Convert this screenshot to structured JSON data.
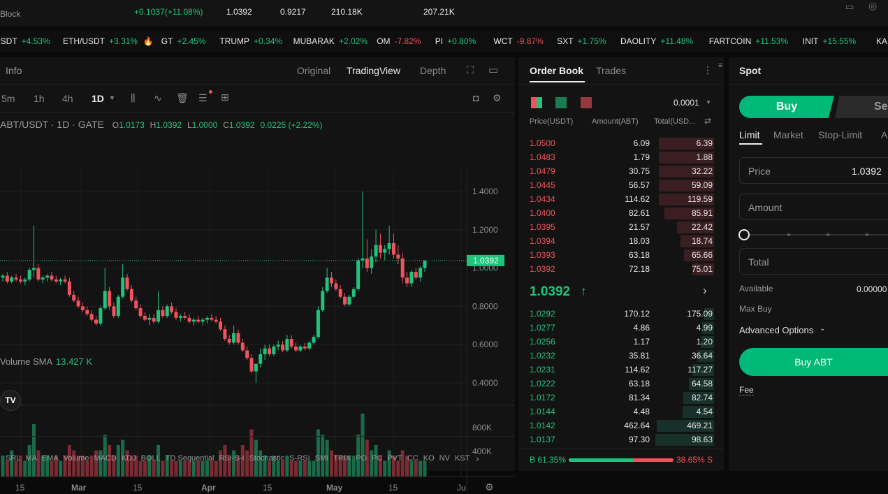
{
  "stats": {
    "left_label": "Block",
    "change": "+0.1037(+11.08%)",
    "high": "1.0392",
    "low": "0.9217",
    "vol1": "210.18K",
    "vol2": "207.21K"
  },
  "ticker": [
    {
      "sym": "USDT",
      "chg": "+4.53%",
      "up": true
    },
    {
      "sym": "ETH/USDT",
      "chg": "+3.31%",
      "up": true
    },
    {
      "sym": "GT",
      "chg": "+2.45%",
      "up": true
    },
    {
      "sym": "TRUMP",
      "chg": "+0.34%",
      "up": true
    },
    {
      "sym": "MUBARAK",
      "chg": "+2.02%",
      "up": true
    },
    {
      "sym": "OM",
      "chg": "-7.82%",
      "up": false
    },
    {
      "sym": "PI",
      "chg": "+0.80%",
      "up": true
    },
    {
      "sym": "WCT",
      "chg": "-9.87%",
      "up": false
    },
    {
      "sym": "SXT",
      "chg": "+1.75%",
      "up": true
    },
    {
      "sym": "DAOLITY",
      "chg": "+11.48%",
      "up": true
    },
    {
      "sym": "FARTCOIN",
      "chg": "+11.53%",
      "up": true
    },
    {
      "sym": "INIT",
      "chg": "+15.55%",
      "up": true
    },
    {
      "sym": "KAIT",
      "chg": "",
      "up": true
    }
  ],
  "chart_panel": {
    "info_tab": "Info",
    "view_tabs": [
      "Original",
      "TradingView",
      "Depth"
    ],
    "active_view": "TradingView",
    "intervals": [
      "5m",
      "1h",
      "4h",
      "1D"
    ],
    "active_interval": "1D",
    "symbol_line": "ABT/USDT · 1D · GATE",
    "o_label": "O",
    "o_val": "1.0173",
    "h_label": "H",
    "h_val": "1.0392",
    "l_label": "L",
    "l_val": "1.0000",
    "c_label": "C",
    "c_val": "1.0392",
    "chg_val": "0.0225 (+2.22%)",
    "volume_label": "Volume SMA",
    "volume_val": "13.427 K",
    "indicators": [
      "SRL",
      "MA",
      "EMA",
      "Volume",
      "MACD",
      "KDJ",
      "BOLL",
      "TD Sequential",
      "RSI-S-I",
      "Stochastic",
      "S-RSI",
      "SMI",
      "TRIX",
      "PO",
      "PC",
      "PVT",
      "CC",
      "KO",
      "NV",
      "KST"
    ]
  },
  "chart_data": {
    "type": "candlestick",
    "price_ticks": [
      "1.4000",
      "1.2000",
      "1.0000",
      "0.8000",
      "0.6000",
      "0.4000"
    ],
    "volume_ticks": [
      "800K",
      "400K"
    ],
    "x_ticks": [
      "15",
      "Mar",
      "15",
      "Apr",
      "15",
      "May",
      "15",
      "Ju"
    ],
    "last_price": "1.0392",
    "ylim": [
      0.3,
      1.5
    ],
    "candles": [
      [
        0.95,
        0.97,
        0.93,
        0.96
      ],
      [
        0.96,
        0.98,
        0.92,
        0.93
      ],
      [
        0.93,
        0.96,
        0.92,
        0.95
      ],
      [
        0.95,
        0.97,
        0.93,
        0.94
      ],
      [
        0.94,
        0.96,
        0.92,
        0.93
      ],
      [
        0.93,
        0.95,
        0.91,
        0.94
      ],
      [
        0.94,
        1.0,
        0.93,
        0.99
      ],
      [
        0.99,
        1.22,
        0.95,
        1.0
      ],
      [
        1.0,
        1.02,
        0.93,
        0.94
      ],
      [
        0.94,
        0.96,
        0.92,
        0.95
      ],
      [
        0.95,
        0.97,
        0.93,
        0.96
      ],
      [
        0.96,
        0.98,
        0.93,
        0.94
      ],
      [
        0.94,
        0.96,
        0.92,
        0.93
      ],
      [
        0.93,
        0.95,
        0.91,
        0.94
      ],
      [
        0.94,
        0.96,
        0.92,
        0.93
      ],
      [
        0.93,
        0.95,
        0.85,
        0.86
      ],
      [
        0.86,
        0.88,
        0.82,
        0.83
      ],
      [
        0.83,
        0.85,
        0.79,
        0.8
      ],
      [
        0.8,
        0.82,
        0.77,
        0.78
      ],
      [
        0.78,
        0.8,
        0.75,
        0.76
      ],
      [
        0.76,
        0.78,
        0.72,
        0.73
      ],
      [
        0.73,
        0.75,
        0.7,
        0.71
      ],
      [
        0.71,
        0.8,
        0.7,
        0.79
      ],
      [
        0.79,
        1.0,
        0.78,
        0.88
      ],
      [
        0.88,
        0.9,
        0.78,
        0.8
      ],
      [
        0.8,
        0.82,
        0.74,
        0.75
      ],
      [
        0.75,
        0.86,
        0.74,
        0.85
      ],
      [
        0.85,
        1.02,
        0.84,
        0.95
      ],
      [
        0.95,
        0.97,
        0.88,
        0.89
      ],
      [
        0.89,
        0.91,
        0.82,
        0.83
      ],
      [
        0.83,
        0.85,
        0.78,
        0.79
      ],
      [
        0.79,
        0.81,
        0.74,
        0.75
      ],
      [
        0.75,
        0.77,
        0.72,
        0.73
      ],
      [
        0.73,
        0.76,
        0.7,
        0.74
      ],
      [
        0.74,
        0.76,
        0.71,
        0.72
      ],
      [
        0.72,
        0.88,
        0.71,
        0.78
      ],
      [
        0.78,
        0.8,
        0.74,
        0.75
      ],
      [
        0.75,
        0.81,
        0.74,
        0.8
      ],
      [
        0.8,
        0.82,
        0.76,
        0.77
      ],
      [
        0.77,
        0.79,
        0.73,
        0.74
      ],
      [
        0.74,
        0.76,
        0.72,
        0.75
      ],
      [
        0.75,
        0.77,
        0.73,
        0.74
      ],
      [
        0.74,
        0.76,
        0.71,
        0.72
      ],
      [
        0.72,
        0.74,
        0.7,
        0.73
      ],
      [
        0.73,
        0.75,
        0.71,
        0.72
      ],
      [
        0.72,
        0.74,
        0.7,
        0.73
      ],
      [
        0.73,
        0.75,
        0.71,
        0.74
      ],
      [
        0.74,
        0.76,
        0.72,
        0.73
      ],
      [
        0.73,
        0.75,
        0.71,
        0.72
      ],
      [
        0.72,
        0.74,
        0.67,
        0.68
      ],
      [
        0.68,
        0.7,
        0.62,
        0.63
      ],
      [
        0.63,
        0.65,
        0.6,
        0.61
      ],
      [
        0.61,
        0.7,
        0.6,
        0.66
      ],
      [
        0.66,
        0.68,
        0.6,
        0.61
      ],
      [
        0.61,
        0.63,
        0.56,
        0.57
      ],
      [
        0.57,
        0.59,
        0.52,
        0.53
      ],
      [
        0.53,
        0.55,
        0.45,
        0.46
      ],
      [
        0.46,
        0.48,
        0.4,
        0.5
      ],
      [
        0.5,
        0.58,
        0.48,
        0.55
      ],
      [
        0.55,
        0.6,
        0.52,
        0.58
      ],
      [
        0.58,
        0.6,
        0.54,
        0.55
      ],
      [
        0.55,
        0.6,
        0.54,
        0.59
      ],
      [
        0.59,
        0.62,
        0.57,
        0.6
      ],
      [
        0.6,
        0.62,
        0.56,
        0.57
      ],
      [
        0.57,
        0.65,
        0.56,
        0.63
      ],
      [
        0.63,
        0.65,
        0.58,
        0.59
      ],
      [
        0.59,
        0.61,
        0.56,
        0.57
      ],
      [
        0.57,
        0.6,
        0.56,
        0.59
      ],
      [
        0.59,
        0.61,
        0.57,
        0.58
      ],
      [
        0.58,
        0.62,
        0.57,
        0.61
      ],
      [
        0.61,
        0.65,
        0.6,
        0.64
      ],
      [
        0.64,
        0.8,
        0.63,
        0.78
      ],
      [
        0.78,
        0.9,
        0.77,
        0.88
      ],
      [
        0.88,
        1.0,
        0.87,
        0.95
      ],
      [
        0.95,
        0.98,
        0.9,
        0.92
      ],
      [
        0.92,
        0.94,
        0.88,
        0.89
      ],
      [
        0.89,
        0.91,
        0.84,
        0.85
      ],
      [
        0.85,
        0.87,
        0.8,
        0.81
      ],
      [
        0.81,
        0.86,
        0.8,
        0.85
      ],
      [
        0.85,
        0.9,
        0.84,
        0.89
      ],
      [
        0.89,
        1.05,
        0.88,
        1.04
      ],
      [
        1.04,
        1.4,
        1.0,
        1.05
      ],
      [
        1.05,
        1.15,
        0.98,
        1.0
      ],
      [
        1.0,
        1.1,
        0.97,
        1.06
      ],
      [
        1.06,
        1.2,
        1.03,
        1.12
      ],
      [
        1.12,
        1.18,
        1.05,
        1.08
      ],
      [
        1.08,
        1.12,
        1.04,
        1.1
      ],
      [
        1.1,
        1.22,
        1.07,
        1.13
      ],
      [
        1.13,
        1.18,
        1.05,
        1.07
      ],
      [
        1.07,
        1.12,
        1.02,
        1.05
      ],
      [
        1.05,
        1.08,
        0.92,
        0.95
      ],
      [
        0.95,
        0.98,
        0.9,
        0.92
      ],
      [
        0.92,
        0.99,
        0.9,
        0.98
      ],
      [
        0.98,
        1.0,
        0.94,
        0.95
      ],
      [
        0.95,
        1.01,
        0.93,
        1.0
      ],
      [
        1.0,
        1.04,
        0.98,
        1.0392
      ]
    ],
    "volumes": [
      4,
      3,
      5,
      3,
      4,
      3,
      6,
      10,
      5,
      4,
      4,
      3,
      4,
      3,
      4,
      6,
      5,
      4,
      4,
      3,
      4,
      5,
      5,
      8,
      6,
      4,
      6,
      7,
      5,
      4,
      4,
      3,
      3,
      4,
      3,
      6,
      3,
      4,
      3,
      3,
      3,
      3,
      3,
      3,
      3,
      3,
      3,
      3,
      3,
      5,
      6,
      4,
      5,
      4,
      6,
      5,
      9,
      7,
      5,
      4,
      3,
      4,
      3,
      3,
      4,
      3,
      3,
      3,
      3,
      3,
      3,
      9,
      8,
      7,
      5,
      4,
      4,
      4,
      4,
      4,
      8,
      12,
      7,
      5,
      6,
      4,
      3,
      5,
      4,
      3,
      5,
      4,
      3,
      3,
      3,
      3
    ]
  },
  "orderbook": {
    "tabs": [
      "Order Book",
      "Trades"
    ],
    "active_tab": "Order Book",
    "precision": "0.0001",
    "col_price": "Price(USDT)",
    "col_amount": "Amount(ABT)",
    "col_total": "Total(USD...",
    "asks": [
      {
        "price": "1.0500",
        "amount": "6.09",
        "total": "6.39",
        "depth": 0.82
      },
      {
        "price": "1.0483",
        "amount": "1.79",
        "total": "1.88",
        "depth": 0.82
      },
      {
        "price": "1.0479",
        "amount": "30.75",
        "total": "32.22",
        "depth": 0.82
      },
      {
        "price": "1.0445",
        "amount": "56.57",
        "total": "59.09",
        "depth": 0.82
      },
      {
        "price": "1.0434",
        "amount": "114.62",
        "total": "119.59",
        "depth": 0.82
      },
      {
        "price": "1.0400",
        "amount": "82.61",
        "total": "85.91",
        "depth": 0.74
      },
      {
        "price": "1.0395",
        "amount": "21.57",
        "total": "22.42",
        "depth": 0.55
      },
      {
        "price": "1.0394",
        "amount": "18.03",
        "total": "18.74",
        "depth": 0.5
      },
      {
        "price": "1.0393",
        "amount": "63.18",
        "total": "65.66",
        "depth": 0.45
      },
      {
        "price": "1.0392",
        "amount": "72.18",
        "total": "75.01",
        "depth": 0.32
      }
    ],
    "mid_price": "1.0392",
    "mid_arrow": "↑",
    "bids": [
      {
        "price": "1.0292",
        "amount": "170.12",
        "total": "175.09",
        "depth": 0.15
      },
      {
        "price": "1.0277",
        "amount": "4.86",
        "total": "4.99",
        "depth": 0.18
      },
      {
        "price": "1.0256",
        "amount": "1.17",
        "total": "1.20",
        "depth": 0.2
      },
      {
        "price": "1.0232",
        "amount": "35.81",
        "total": "36.64",
        "depth": 0.25
      },
      {
        "price": "1.0231",
        "amount": "114.62",
        "total": "117.27",
        "depth": 0.32
      },
      {
        "price": "1.0222",
        "amount": "63.18",
        "total": "64.58",
        "depth": 0.38
      },
      {
        "price": "1.0172",
        "amount": "81.34",
        "total": "82.74",
        "depth": 0.46
      },
      {
        "price": "1.0144",
        "amount": "4.48",
        "total": "4.54",
        "depth": 0.47
      },
      {
        "price": "1.0142",
        "amount": "462.64",
        "total": "469.21",
        "depth": 0.85
      },
      {
        "price": "1.0137",
        "amount": "97.30",
        "total": "98.63",
        "depth": 0.88
      }
    ],
    "buy_ratio": "B 61.35%",
    "sell_ratio": "38.65% S",
    "buy_fraction": 0.6135
  },
  "spot": {
    "title": "Spot",
    "buy_label": "Buy",
    "sell_label": "Se",
    "order_types": [
      "Limit",
      "Market",
      "Stop-Limit",
      "A"
    ],
    "active_type": "Limit",
    "price_label": "Price",
    "price_value": "1.0392",
    "amount_label": "Amount",
    "total_label": "Total",
    "available_label": "Available",
    "available_value": "0.00000",
    "maxbuy_label": "Max Buy",
    "advanced_label": "Advanced Options",
    "submit_label": "Buy ABT",
    "fee_label": "Fee"
  },
  "colors": {
    "up": "#20c37c",
    "down": "#f0525e",
    "accent": "#00b877",
    "panel": "#131313"
  }
}
